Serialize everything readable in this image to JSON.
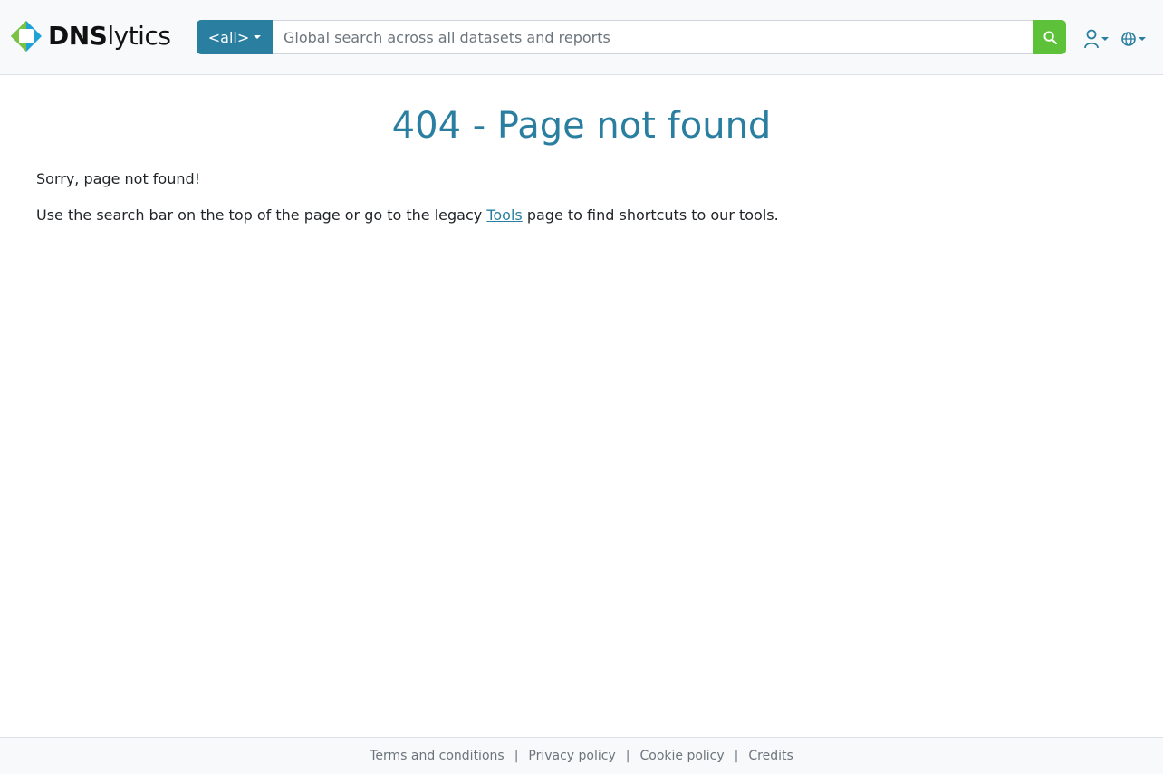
{
  "header": {
    "brand": {
      "prefix": "DNS",
      "suffix": "lytics",
      "colors": {
        "left": "#7cc242",
        "top": "#1fa3d6",
        "right": "#1fa3d6",
        "bottom": "#7cc242"
      }
    },
    "search": {
      "scope_label": "<all>",
      "placeholder": "Global search across all datasets and reports",
      "value": "",
      "button_icon": "search-icon"
    },
    "icons": [
      {
        "name": "user-icon"
      },
      {
        "name": "language-icon"
      }
    ]
  },
  "main": {
    "title": "404 - Page not found",
    "line1": "Sorry, page not found!",
    "line2": {
      "before": "Use the search bar on the top of the page or go to the legacy ",
      "link": "Tools",
      "after": " page to find shortcuts to our tools."
    }
  },
  "footer": {
    "links": [
      "Terms and conditions",
      "Privacy policy",
      "Cookie policy",
      "Credits"
    ],
    "separator": "|"
  },
  "colors": {
    "accent": "#2a7fa0",
    "search_button": "#5dc23a",
    "navbar_bg": "#f8f9fa"
  }
}
